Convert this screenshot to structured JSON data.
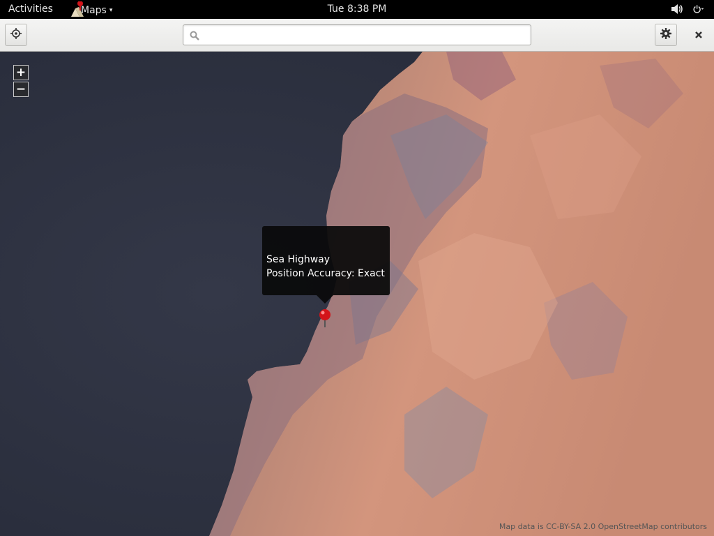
{
  "topbar": {
    "activities": "Activities",
    "app_name": "Maps",
    "clock": "Tue  8:38 PM",
    "icons": [
      "maps-app-icon",
      "volume-icon",
      "power-icon"
    ]
  },
  "header": {
    "locate_icon": "locate-icon",
    "search": {
      "value": "",
      "placeholder": ""
    },
    "settings_icon": "gear-icon",
    "close_icon": "close-icon"
  },
  "map": {
    "zoom_in": "+",
    "zoom_out": "−",
    "place": {
      "name": "Sea Highway",
      "accuracy": "Position Accuracy: Exact"
    },
    "attribution": "Map data is CC-BY-SA 2.0 OpenStreetMap contributors"
  },
  "colors": {
    "sea": "#2d3140",
    "land": "#c98e7b",
    "pin": "#d3141a"
  }
}
